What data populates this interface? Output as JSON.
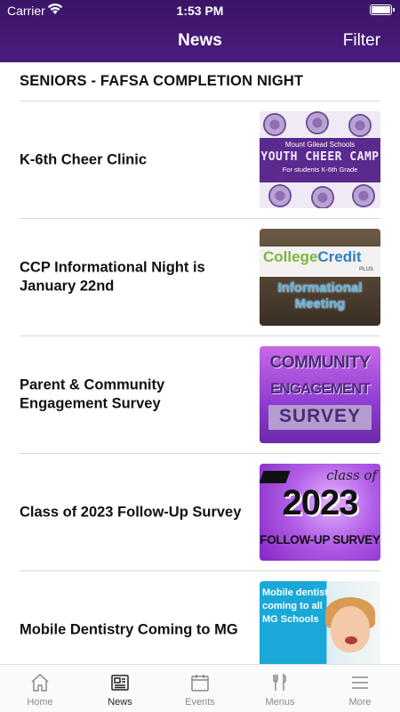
{
  "status_bar": {
    "carrier": "Carrier",
    "time": "1:53 PM"
  },
  "header": {
    "title": "News",
    "filter_label": "Filter"
  },
  "top_headline": "SENIORS - FAFSA COMPLETION NIGHT",
  "news_items": [
    {
      "title": "K-6th Cheer Clinic",
      "thumb": {
        "line1": "Mount Gilead Schools",
        "line2": "YOUTH CHEER CAMP",
        "line3": "For students K-6th Grade"
      }
    },
    {
      "title": "CCP Informational Night is January 22nd",
      "thumb": {
        "brand_a": "College",
        "brand_b": "Credit",
        "brand_plus": "PLUS",
        "line1": "Informational",
        "line2": "Meeting"
      }
    },
    {
      "title": "Parent & Community Engagement Survey",
      "thumb": {
        "line1": "COMMUNITY",
        "line2": "ENGAGEMENT",
        "line3": "SURVEY"
      }
    },
    {
      "title": "Class of 2023 Follow-Up Survey",
      "thumb": {
        "line1": "class of",
        "line2": "2023",
        "line3": "FOLLOW-UP SURVEY"
      }
    },
    {
      "title": "Mobile Dentistry Coming to MG",
      "thumb": {
        "text": "Mobile dentist coming to all MG Schools"
      }
    }
  ],
  "tabs": [
    {
      "label": "Home",
      "icon": "home-icon",
      "active": false
    },
    {
      "label": "News",
      "icon": "newspaper-icon",
      "active": true
    },
    {
      "label": "Events",
      "icon": "calendar-icon",
      "active": false
    },
    {
      "label": "Menus",
      "icon": "utensils-icon",
      "active": false
    },
    {
      "label": "More",
      "icon": "menu-icon",
      "active": false
    }
  ],
  "colors": {
    "header_bg": "#4a1d7e",
    "tab_active": "#222222",
    "tab_inactive": "#8a8a8a"
  }
}
